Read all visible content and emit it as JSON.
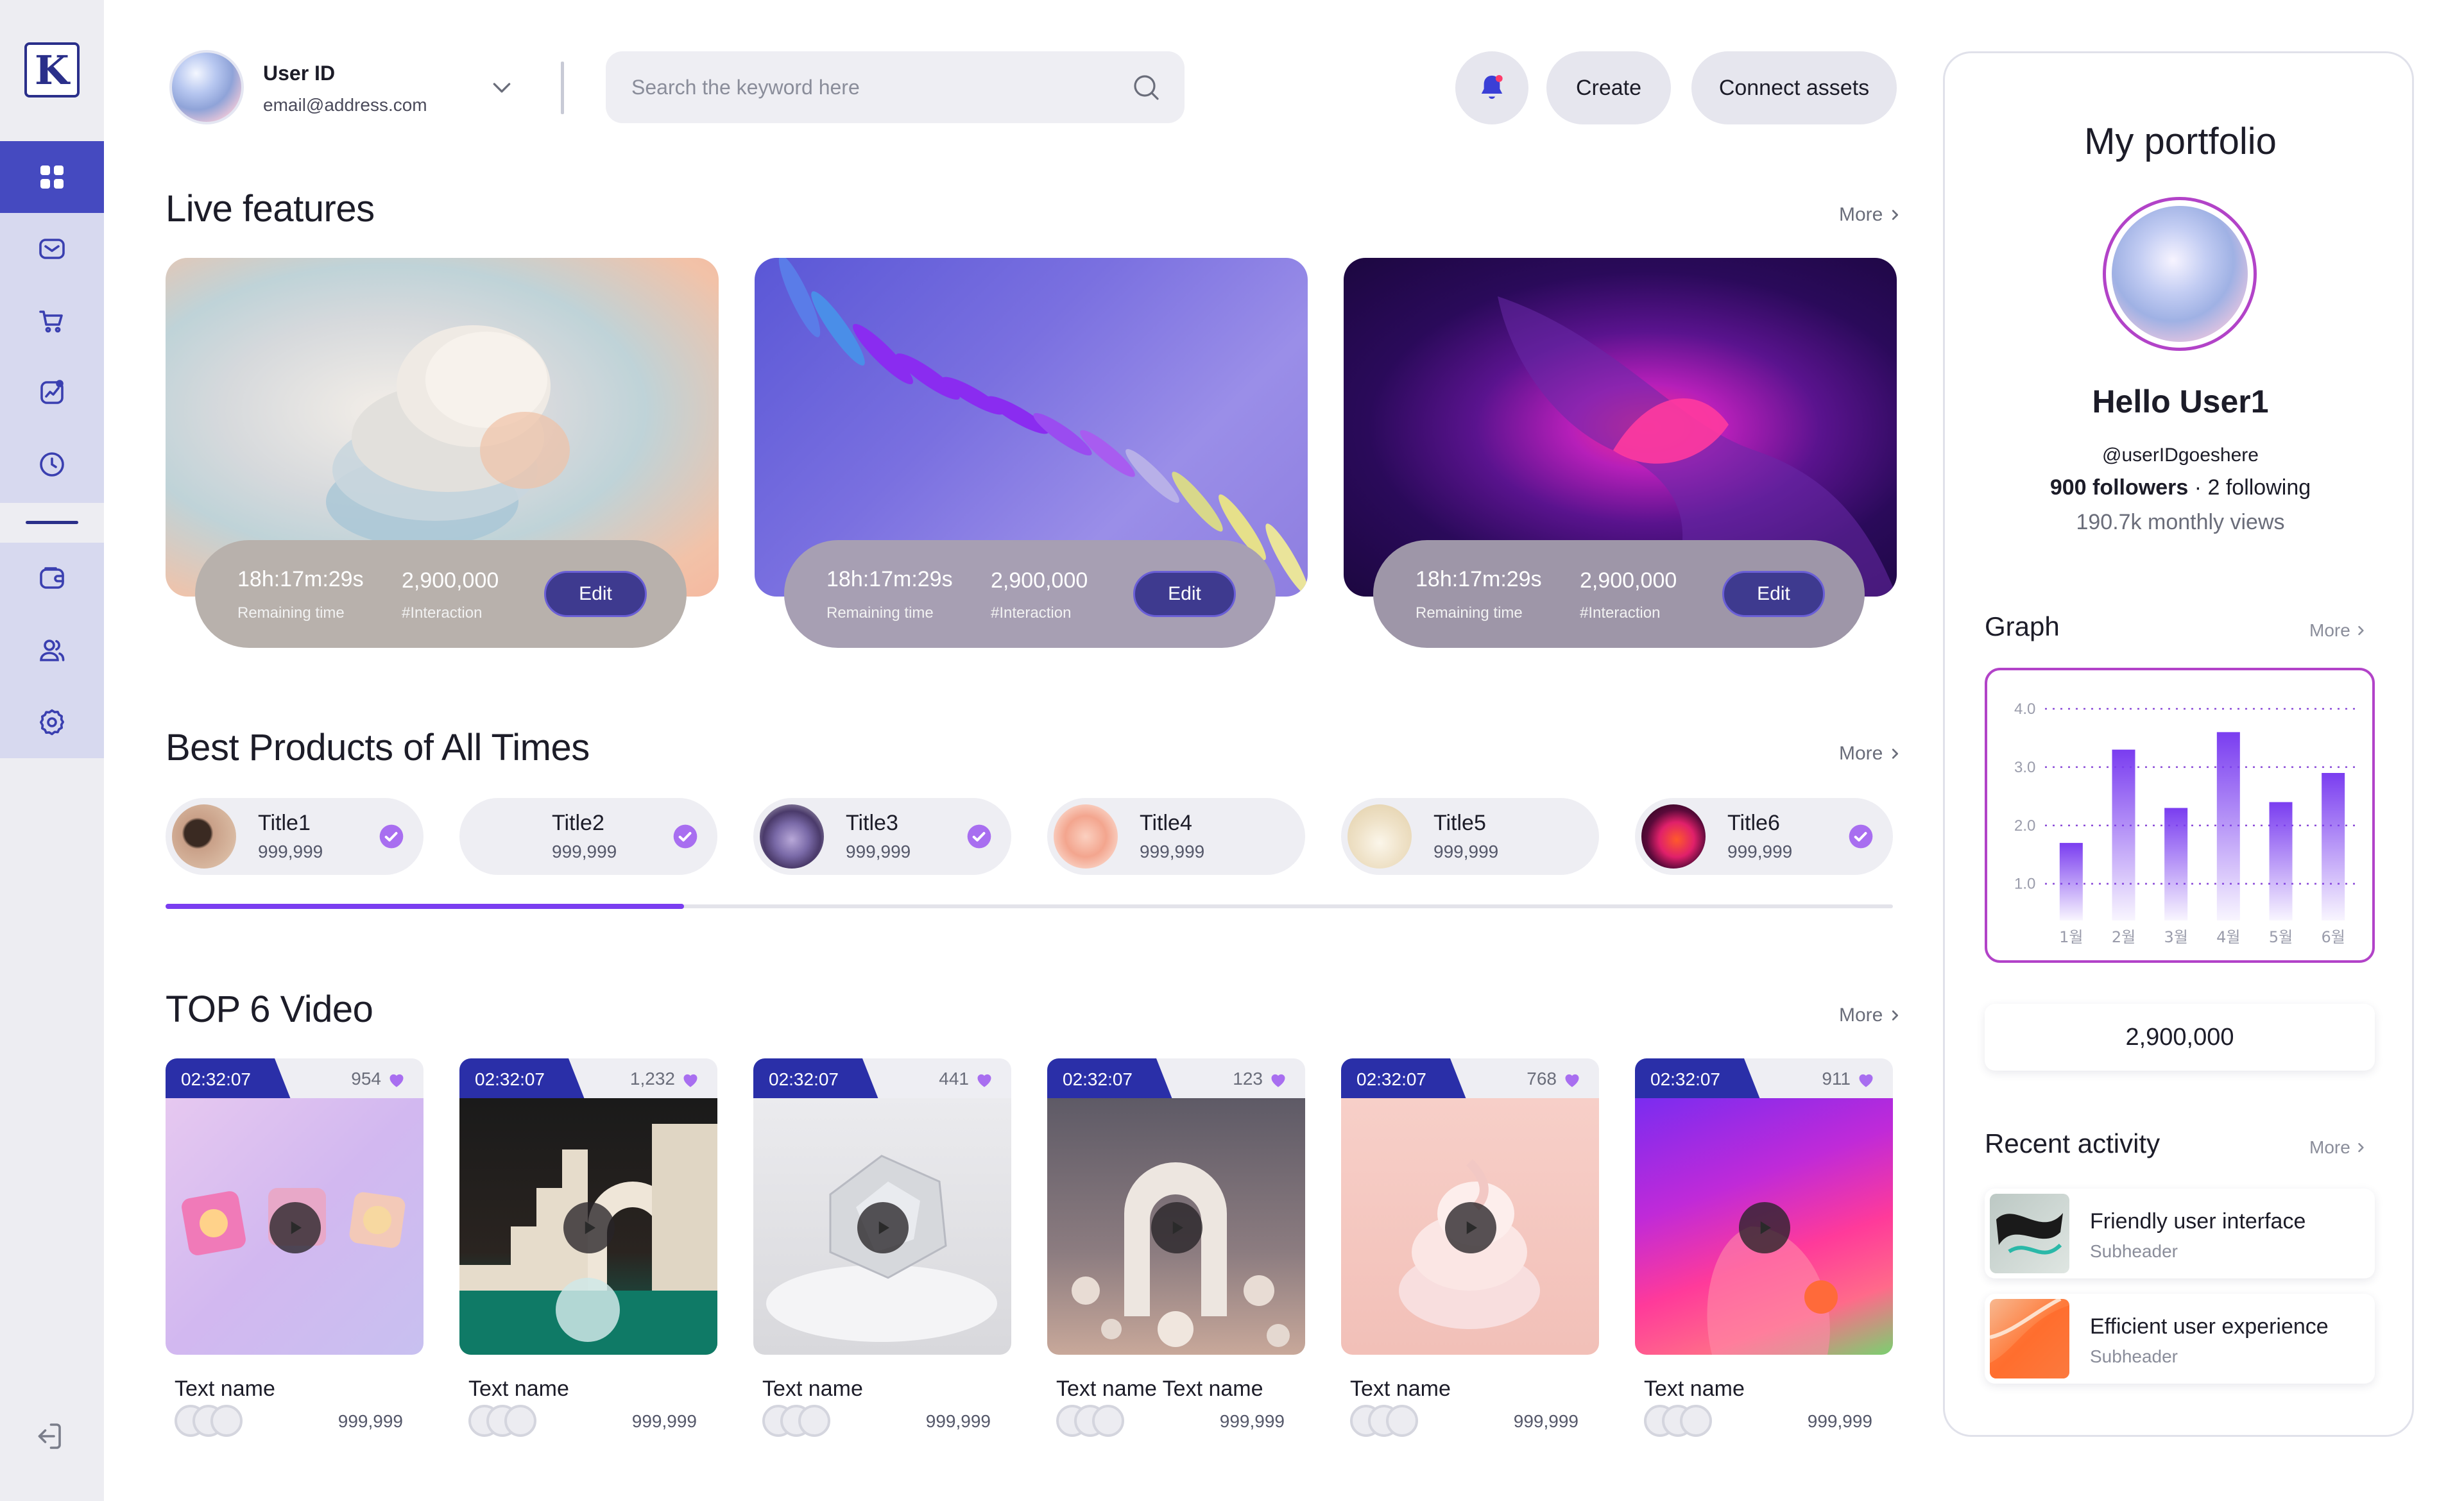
{
  "sidebar": {
    "logo_text": "K",
    "items": [
      {
        "name": "dashboard",
        "icon": "grid-icon",
        "active": true
      },
      {
        "name": "messages",
        "icon": "mail-icon",
        "active": false
      },
      {
        "name": "cart",
        "icon": "cart-icon",
        "active": false
      },
      {
        "name": "analytics",
        "icon": "chart-icon",
        "active": false
      },
      {
        "name": "history",
        "icon": "clock-icon",
        "active": false
      },
      {
        "name": "wallet",
        "icon": "wallet-icon",
        "active": false
      },
      {
        "name": "users",
        "icon": "users-icon",
        "active": false
      },
      {
        "name": "settings",
        "icon": "gear-icon",
        "active": false
      }
    ],
    "logout_icon": "logout-icon"
  },
  "header": {
    "user_name": "User ID",
    "user_email": "email@address.com",
    "search_placeholder": "Search the keyword here",
    "create_label": "Create",
    "connect_label": "Connect assets"
  },
  "live": {
    "title": "Live features",
    "more": "More",
    "cards": [
      {
        "time": "18h:17m:29s",
        "time_label": "Remaining time",
        "count": "2,900,000",
        "count_label": "#Interaction",
        "edit": "Edit"
      },
      {
        "time": "18h:17m:29s",
        "time_label": "Remaining time",
        "count": "2,900,000",
        "count_label": "#Interaction",
        "edit": "Edit"
      },
      {
        "time": "18h:17m:29s",
        "time_label": "Remaining time",
        "count": "2,900,000",
        "count_label": "#Interaction",
        "edit": "Edit"
      }
    ]
  },
  "best": {
    "title": "Best Products of All Times",
    "more": "More",
    "progress": 0.3,
    "products": [
      {
        "title": "Title1",
        "value": "999,999",
        "badge": true
      },
      {
        "title": "Title2",
        "value": "999,999",
        "badge": true
      },
      {
        "title": "Title3",
        "value": "999,999",
        "badge": true
      },
      {
        "title": "Title4",
        "value": "999,999",
        "badge": false
      },
      {
        "title": "Title5",
        "value": "999,999",
        "badge": false
      },
      {
        "title": "Title6",
        "value": "999,999",
        "badge": true
      }
    ]
  },
  "videos": {
    "title": "TOP 6 Video",
    "more": "More",
    "items": [
      {
        "duration": "02:32:07",
        "likes": "954",
        "name": "Text name",
        "count": "999,999"
      },
      {
        "duration": "02:32:07",
        "likes": "1,232",
        "name": "Text name",
        "count": "999,999"
      },
      {
        "duration": "02:32:07",
        "likes": "441",
        "name": "Text name",
        "count": "999,999"
      },
      {
        "duration": "02:32:07",
        "likes": "123",
        "name": "Text name Text name",
        "count": "999,999"
      },
      {
        "duration": "02:32:07",
        "likes": "768",
        "name": "Text name",
        "count": "999,999"
      },
      {
        "duration": "02:32:07",
        "likes": "911",
        "name": "Text name",
        "count": "999,999"
      }
    ]
  },
  "portfolio": {
    "title": "My portfolio",
    "hello": "Hello User1",
    "handle": "@userIDgoeshere",
    "followers": "900 followers",
    "following": "2 following",
    "views": "190.7k monthly views",
    "graph_title": "Graph",
    "graph_more": "More",
    "total": "2,900,000",
    "recent_title": "Recent activity",
    "recent_more": "More",
    "activities": [
      {
        "title": "Friendly user interface",
        "sub": "Subheader"
      },
      {
        "title": "Efficient user experience",
        "sub": "Subheader"
      }
    ]
  },
  "chart_data": {
    "type": "bar",
    "categories": [
      "1월",
      "2월",
      "3월",
      "4월",
      "5월",
      "6월"
    ],
    "values": [
      1.7,
      3.3,
      2.3,
      3.6,
      2.4,
      2.9
    ],
    "yticks": [
      "1.0",
      "2.0",
      "3.0",
      "4.0"
    ],
    "ylim": [
      0.7,
      4.0
    ],
    "grid": true,
    "bar_color": "#7a3df0"
  },
  "colors": {
    "accent": "#7a3df0",
    "sidebar_active": "#454ac0",
    "navy": "#2a2fa8",
    "portfolio_ring": "#b243c8"
  }
}
